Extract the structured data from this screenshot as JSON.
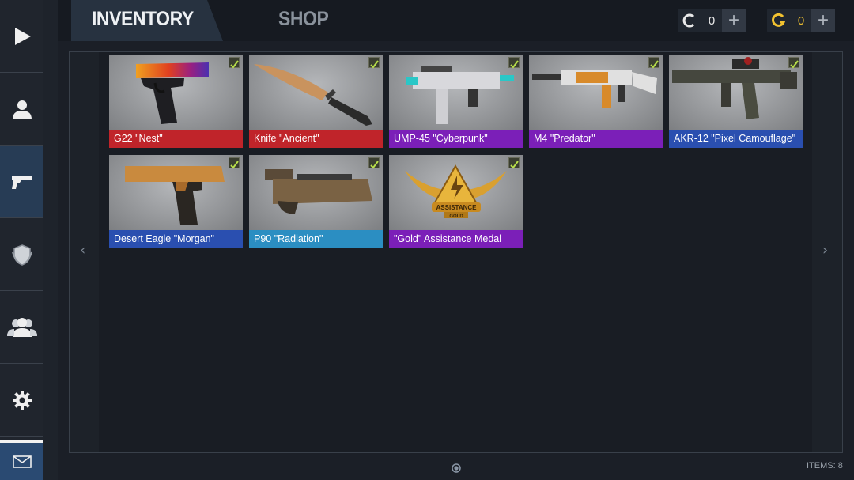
{
  "tabs": {
    "inventory": "INVENTORY",
    "shop": "SHOP"
  },
  "currencies": [
    {
      "icon": "credits-icon",
      "value": "0"
    },
    {
      "icon": "gold-icon",
      "value": "0"
    }
  ],
  "sidebar": [
    "play-icon",
    "profile-icon",
    "weapons-icon",
    "clan-shield-icon",
    "friends-icon",
    "settings-icon",
    "mail-icon"
  ],
  "items": [
    {
      "name": "G22 \"Nest\"",
      "rarity_color": "#c0242a"
    },
    {
      "name": "Knife \"Ancient\"",
      "rarity_color": "#c0242a"
    },
    {
      "name": "UMP-45 \"Cyberpunk\"",
      "rarity_color": "#7b1fb8"
    },
    {
      "name": "M4 \"Predator\"",
      "rarity_color": "#7b1fb8"
    },
    {
      "name": "AKR-12 \"Pixel Camouflage\"",
      "rarity_color": "#2a4fb0"
    },
    {
      "name": "Desert Eagle \"Morgan\"",
      "rarity_color": "#2a4fb0"
    },
    {
      "name": "P90 \"Radiation\"",
      "rarity_color": "#2b8ec2"
    },
    {
      "name": "\"Gold\" Assistance Medal",
      "rarity_color": "#7b1fb8"
    }
  ],
  "medal_text": {
    "line1": "ASSISTANCE",
    "line2": "GOLD"
  },
  "footer": {
    "items_count": "ITEMS: 8"
  },
  "nav": {
    "prev": "‹",
    "next": "›"
  }
}
